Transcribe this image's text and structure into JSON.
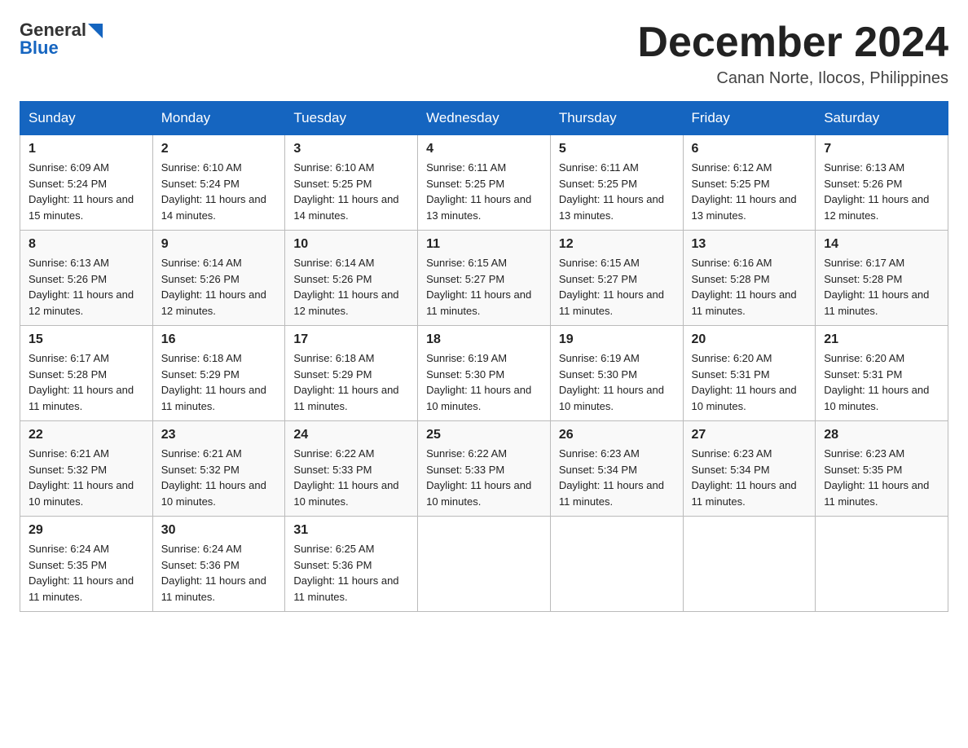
{
  "header": {
    "logo_general": "General",
    "logo_blue": "Blue",
    "title": "December 2024",
    "subtitle": "Canan Norte, Ilocos, Philippines"
  },
  "days_of_week": [
    "Sunday",
    "Monday",
    "Tuesday",
    "Wednesday",
    "Thursday",
    "Friday",
    "Saturday"
  ],
  "weeks": [
    [
      {
        "day": "1",
        "sunrise": "6:09 AM",
        "sunset": "5:24 PM",
        "daylight": "11 hours and 15 minutes."
      },
      {
        "day": "2",
        "sunrise": "6:10 AM",
        "sunset": "5:24 PM",
        "daylight": "11 hours and 14 minutes."
      },
      {
        "day": "3",
        "sunrise": "6:10 AM",
        "sunset": "5:25 PM",
        "daylight": "11 hours and 14 minutes."
      },
      {
        "day": "4",
        "sunrise": "6:11 AM",
        "sunset": "5:25 PM",
        "daylight": "11 hours and 13 minutes."
      },
      {
        "day": "5",
        "sunrise": "6:11 AM",
        "sunset": "5:25 PM",
        "daylight": "11 hours and 13 minutes."
      },
      {
        "day": "6",
        "sunrise": "6:12 AM",
        "sunset": "5:25 PM",
        "daylight": "11 hours and 13 minutes."
      },
      {
        "day": "7",
        "sunrise": "6:13 AM",
        "sunset": "5:26 PM",
        "daylight": "11 hours and 12 minutes."
      }
    ],
    [
      {
        "day": "8",
        "sunrise": "6:13 AM",
        "sunset": "5:26 PM",
        "daylight": "11 hours and 12 minutes."
      },
      {
        "day": "9",
        "sunrise": "6:14 AM",
        "sunset": "5:26 PM",
        "daylight": "11 hours and 12 minutes."
      },
      {
        "day": "10",
        "sunrise": "6:14 AM",
        "sunset": "5:26 PM",
        "daylight": "11 hours and 12 minutes."
      },
      {
        "day": "11",
        "sunrise": "6:15 AM",
        "sunset": "5:27 PM",
        "daylight": "11 hours and 11 minutes."
      },
      {
        "day": "12",
        "sunrise": "6:15 AM",
        "sunset": "5:27 PM",
        "daylight": "11 hours and 11 minutes."
      },
      {
        "day": "13",
        "sunrise": "6:16 AM",
        "sunset": "5:28 PM",
        "daylight": "11 hours and 11 minutes."
      },
      {
        "day": "14",
        "sunrise": "6:17 AM",
        "sunset": "5:28 PM",
        "daylight": "11 hours and 11 minutes."
      }
    ],
    [
      {
        "day": "15",
        "sunrise": "6:17 AM",
        "sunset": "5:28 PM",
        "daylight": "11 hours and 11 minutes."
      },
      {
        "day": "16",
        "sunrise": "6:18 AM",
        "sunset": "5:29 PM",
        "daylight": "11 hours and 11 minutes."
      },
      {
        "day": "17",
        "sunrise": "6:18 AM",
        "sunset": "5:29 PM",
        "daylight": "11 hours and 11 minutes."
      },
      {
        "day": "18",
        "sunrise": "6:19 AM",
        "sunset": "5:30 PM",
        "daylight": "11 hours and 10 minutes."
      },
      {
        "day": "19",
        "sunrise": "6:19 AM",
        "sunset": "5:30 PM",
        "daylight": "11 hours and 10 minutes."
      },
      {
        "day": "20",
        "sunrise": "6:20 AM",
        "sunset": "5:31 PM",
        "daylight": "11 hours and 10 minutes."
      },
      {
        "day": "21",
        "sunrise": "6:20 AM",
        "sunset": "5:31 PM",
        "daylight": "11 hours and 10 minutes."
      }
    ],
    [
      {
        "day": "22",
        "sunrise": "6:21 AM",
        "sunset": "5:32 PM",
        "daylight": "11 hours and 10 minutes."
      },
      {
        "day": "23",
        "sunrise": "6:21 AM",
        "sunset": "5:32 PM",
        "daylight": "11 hours and 10 minutes."
      },
      {
        "day": "24",
        "sunrise": "6:22 AM",
        "sunset": "5:33 PM",
        "daylight": "11 hours and 10 minutes."
      },
      {
        "day": "25",
        "sunrise": "6:22 AM",
        "sunset": "5:33 PM",
        "daylight": "11 hours and 10 minutes."
      },
      {
        "day": "26",
        "sunrise": "6:23 AM",
        "sunset": "5:34 PM",
        "daylight": "11 hours and 11 minutes."
      },
      {
        "day": "27",
        "sunrise": "6:23 AM",
        "sunset": "5:34 PM",
        "daylight": "11 hours and 11 minutes."
      },
      {
        "day": "28",
        "sunrise": "6:23 AM",
        "sunset": "5:35 PM",
        "daylight": "11 hours and 11 minutes."
      }
    ],
    [
      {
        "day": "29",
        "sunrise": "6:24 AM",
        "sunset": "5:35 PM",
        "daylight": "11 hours and 11 minutes."
      },
      {
        "day": "30",
        "sunrise": "6:24 AM",
        "sunset": "5:36 PM",
        "daylight": "11 hours and 11 minutes."
      },
      {
        "day": "31",
        "sunrise": "6:25 AM",
        "sunset": "5:36 PM",
        "daylight": "11 hours and 11 minutes."
      },
      null,
      null,
      null,
      null
    ]
  ]
}
